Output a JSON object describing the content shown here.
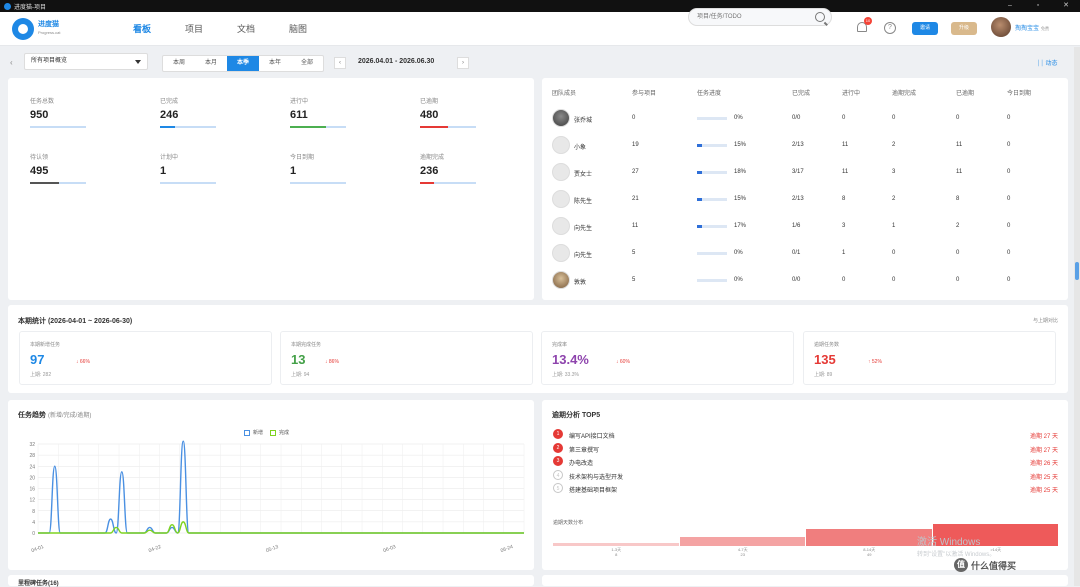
{
  "window": {
    "title": "进度猫-项目",
    "controls": [
      "–",
      "▫",
      "✕"
    ]
  },
  "brand": {
    "name": "进度猫",
    "sub": "Progress.cat"
  },
  "nav": {
    "tabs": [
      "看板",
      "项目",
      "文档",
      "脑图"
    ]
  },
  "search": {
    "placeholder": "项目/任务/TODO"
  },
  "notifications": {
    "count": "10"
  },
  "help": "?",
  "buttons": {
    "invite": "邀请",
    "upgrade": "升级"
  },
  "user": {
    "name": "掏掏宝宝",
    "tag": "免费"
  },
  "filters": {
    "project": "所有项目概览",
    "periods": [
      "本周",
      "本月",
      "本季",
      "本年",
      "全部"
    ],
    "active_period": "本季",
    "prev": "‹",
    "next": "›",
    "range": "2026.04.01 - 2026.06.30",
    "dynamic": "动态",
    "back": "‹"
  },
  "stats": [
    {
      "label": "任务总数",
      "value": "950",
      "color": "#1e88e5",
      "fill": 0
    },
    {
      "label": "已完成",
      "value": "246",
      "color": "#1e88e5",
      "fill": 0.26
    },
    {
      "label": "进行中",
      "value": "611",
      "color": "#4caf50",
      "fill": 0.64
    },
    {
      "label": "已逾期",
      "value": "480",
      "color": "#e53935",
      "fill": 0.5
    },
    {
      "label": "待认领",
      "value": "495",
      "color": "#555555",
      "fill": 0.52
    },
    {
      "label": "计划中",
      "value": "1",
      "color": "#1e88e5",
      "fill": 0
    },
    {
      "label": "今日到期",
      "value": "1",
      "color": "#1e88e5",
      "fill": 0
    },
    {
      "label": "逾期完成",
      "value": "236",
      "color": "#e53935",
      "fill": 0.25
    }
  ],
  "team": {
    "headers": [
      "团队成员",
      "参与项目",
      "任务进度",
      "已完成",
      "进行中",
      "逾期完成",
      "已逾期",
      "今日到期"
    ],
    "rows": [
      {
        "name": "张乔城",
        "projects": "0",
        "progress": "0%",
        "fill": 0,
        "done": "0/0",
        "ongoing": "0",
        "overdue_done": "0",
        "overdue": "0",
        "today": "0",
        "avatar": "photo"
      },
      {
        "name": "小象",
        "projects": "19",
        "progress": "15%",
        "fill": 0.15,
        "done": "2/13",
        "ongoing": "11",
        "overdue_done": "2",
        "overdue": "11",
        "today": "0",
        "avatar": "default"
      },
      {
        "name": "贾女士",
        "projects": "27",
        "progress": "18%",
        "fill": 0.18,
        "done": "3/17",
        "ongoing": "11",
        "overdue_done": "3",
        "overdue": "11",
        "today": "0",
        "avatar": "default"
      },
      {
        "name": "陈先生",
        "projects": "21",
        "progress": "15%",
        "fill": 0.15,
        "done": "2/13",
        "ongoing": "8",
        "overdue_done": "2",
        "overdue": "8",
        "today": "0",
        "avatar": "default"
      },
      {
        "name": "向先生",
        "projects": "11",
        "progress": "17%",
        "fill": 0.17,
        "done": "1/6",
        "ongoing": "3",
        "overdue_done": "1",
        "overdue": "2",
        "today": "0",
        "avatar": "default"
      },
      {
        "name": "向先生",
        "projects": "5",
        "progress": "0%",
        "fill": 0,
        "done": "0/1",
        "ongoing": "1",
        "overdue_done": "0",
        "overdue": "0",
        "today": "0",
        "avatar": "default"
      },
      {
        "name": "敦敦",
        "projects": "5",
        "progress": "0%",
        "fill": 0,
        "done": "0/0",
        "ongoing": "0",
        "overdue_done": "0",
        "overdue": "0",
        "today": "0",
        "avatar": "photo2"
      }
    ]
  },
  "period_stats": {
    "title": "本期统计 (2026-04-01 ~ 2026-06-30)",
    "compare": "与上期对比",
    "kpis": [
      {
        "label": "本期新增任务",
        "value": "97",
        "change": "↓ 66%",
        "prev": "上期: 282",
        "color": "#1e88e5"
      },
      {
        "label": "本期完成任务",
        "value": "13",
        "change": "↓ 86%",
        "prev": "上期: 94",
        "color": "#43a047"
      },
      {
        "label": "完成率",
        "value": "13.4%",
        "change": "↓ 60%",
        "prev": "上期: 33.3%",
        "color": "#8e44ad"
      },
      {
        "label": "逾期任务数",
        "value": "135",
        "change": "↑ 52%",
        "prev": "上期: 89",
        "color": "#e53935"
      }
    ]
  },
  "trend": {
    "title": "任务趋势",
    "subtitle": "(新增/完成/逾期)"
  },
  "overdue": {
    "title": "逾期分析 TOP5",
    "items": [
      {
        "rank": "1",
        "name": "编写API接口文档",
        "days": "逾期 27 天",
        "color": "#e53935"
      },
      {
        "rank": "2",
        "name": "第三章撰写",
        "days": "逾期 27 天",
        "color": "#e53935"
      },
      {
        "rank": "3",
        "name": "办电改造",
        "days": "逾期 26 天",
        "color": "#e53935"
      },
      {
        "rank": "4",
        "name": "技术架构与选型开发",
        "days": "逾期 25 天",
        "color": "#c7c7c7"
      },
      {
        "rank": "5",
        "name": "搭建基础项目框架",
        "days": "逾期 25 天",
        "color": "#c7c7c7"
      }
    ],
    "dist_title": "逾期天数分布",
    "dist": [
      {
        "label": "1-3天",
        "value": "8"
      },
      {
        "label": "4-7天",
        "value": "23"
      },
      {
        "label": "8-14天",
        "value": "49"
      },
      {
        "label": ">14天",
        "value": ""
      }
    ]
  },
  "milestone": {
    "title": "里程碑任务(16)"
  },
  "watermark": {
    "line1": "激活 Windows",
    "line2": "转到\"设置\"以激活 Windows。"
  },
  "smzdm": "什么值得买",
  "chart_data": {
    "type": "line",
    "title": "",
    "legend": [
      "新增",
      "完成"
    ],
    "legend_placement": "top-center",
    "colors": {
      "新增": "#4a90e2",
      "完成": "#7ed321"
    },
    "x_ticks": [
      "04-01",
      "04-22",
      "05-13",
      "06-03",
      "06-24"
    ],
    "ylim": [
      0,
      32
    ],
    "y_ticks": [
      0,
      4,
      8,
      12,
      16,
      20,
      24,
      28,
      32
    ],
    "grid": true,
    "series": [
      {
        "name": "新增",
        "points": [
          [
            0,
            0
          ],
          [
            2,
            0
          ],
          [
            3,
            24
          ],
          [
            4,
            0
          ],
          [
            12,
            0
          ],
          [
            13,
            5
          ],
          [
            14,
            0
          ],
          [
            15,
            22
          ],
          [
            16,
            0
          ],
          [
            19,
            0
          ],
          [
            20,
            2
          ],
          [
            21,
            0
          ],
          [
            23,
            0
          ],
          [
            24,
            2
          ],
          [
            25,
            0
          ],
          [
            26,
            33
          ],
          [
            27,
            0
          ],
          [
            87,
            0
          ]
        ]
      },
      {
        "name": "完成",
        "points": [
          [
            0,
            0
          ],
          [
            13,
            0
          ],
          [
            14,
            2
          ],
          [
            15,
            0
          ],
          [
            19,
            0
          ],
          [
            20,
            1
          ],
          [
            21,
            0
          ],
          [
            23,
            0
          ],
          [
            24,
            3
          ],
          [
            25,
            0
          ],
          [
            26,
            4
          ],
          [
            27,
            0
          ],
          [
            87,
            0
          ]
        ]
      }
    ]
  }
}
